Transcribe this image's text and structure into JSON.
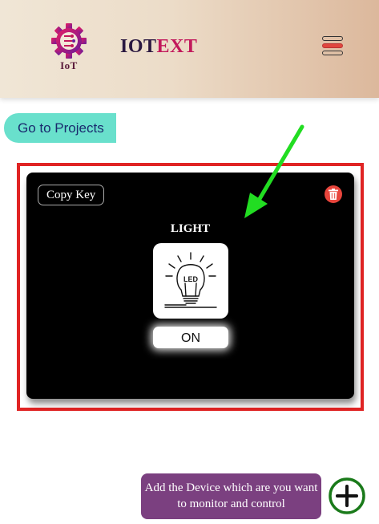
{
  "header": {
    "logo_text": "IoT",
    "brand_part1": "IOT",
    "brand_part2": "EXT",
    "menu_icon": "hamburger-menu-icon"
  },
  "nav": {
    "projects_button_label": "Go to Projects"
  },
  "device_card": {
    "copy_key_label": "Copy Key",
    "delete_icon": "trash-icon",
    "device_name": "LIGHT",
    "device_icon": "led-bulb-icon",
    "device_icon_text": "LED",
    "state_button_label": "ON"
  },
  "annotation": {
    "arrow_color": "#22dd22",
    "highlight_color": "#e02424"
  },
  "footer": {
    "tooltip_text": "Add the Device which are you want to monitor and control",
    "add_icon": "plus-circle-icon"
  },
  "colors": {
    "accent_teal": "#69e0cc",
    "brand_magenta": "#c2185b",
    "tooltip_purple": "#7b4080",
    "add_green": "#1a7a1a"
  }
}
